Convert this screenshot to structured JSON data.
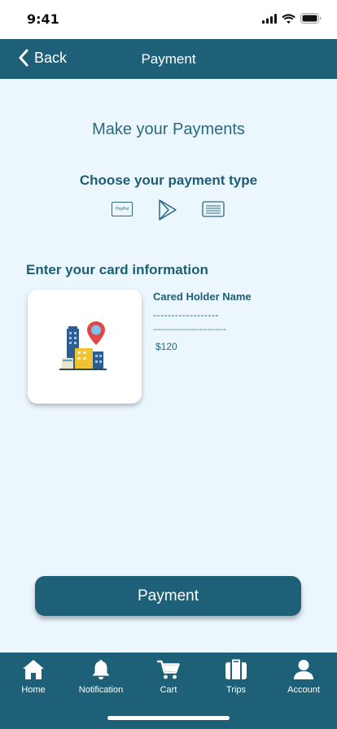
{
  "status_bar": {
    "time": "9:41"
  },
  "nav": {
    "back_label": "Back",
    "title": "Payment"
  },
  "main": {
    "headline": "Make your Payments",
    "payment_type_title": "Choose your payment type",
    "payment_types": [
      {
        "icon": "paypal-icon",
        "label": "PayPal"
      },
      {
        "icon": "play-icon"
      },
      {
        "icon": "card-icon"
      }
    ],
    "card_section_title": "Enter your card information",
    "card": {
      "holder_name": "Cared Holder Name",
      "line_1": "------------------",
      "line_2": "---------------------------",
      "amount": "$120"
    },
    "payment_button": "Payment"
  },
  "tab_bar": {
    "items": [
      {
        "label": "Home",
        "icon": "home-icon"
      },
      {
        "label": "Notification",
        "icon": "bell-icon"
      },
      {
        "label": "Cart",
        "icon": "cart-icon"
      },
      {
        "label": "Trips",
        "icon": "suitcase-icon"
      },
      {
        "label": "Account",
        "icon": "person-icon"
      }
    ]
  },
  "colors": {
    "primary": "#1e6078",
    "background": "#ecf6fd"
  }
}
